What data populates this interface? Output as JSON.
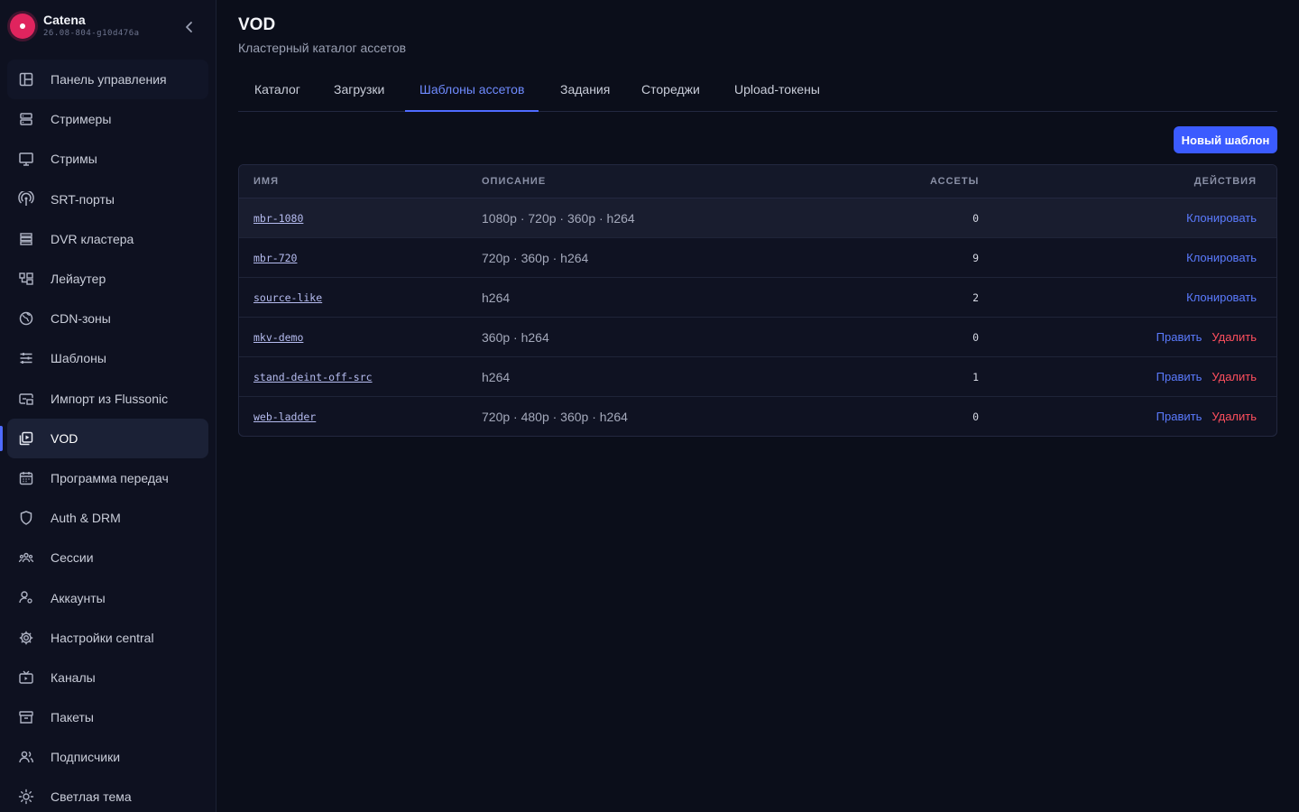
{
  "brand": {
    "name": "Catena",
    "version": "26.08-804-g10d476a"
  },
  "sidebar": {
    "items": [
      {
        "label": "Панель управления",
        "icon": "dashboard-icon"
      },
      {
        "label": "Стримеры",
        "icon": "server-icon"
      },
      {
        "label": "Стримы",
        "icon": "monitor-icon"
      },
      {
        "label": "SRT-порты",
        "icon": "antenna-icon"
      },
      {
        "label": "DVR кластера",
        "icon": "stack-icon"
      },
      {
        "label": "Лейаутер",
        "icon": "layout-icon"
      },
      {
        "label": "CDN-зоны",
        "icon": "globe-icon"
      },
      {
        "label": "Шаблоны",
        "icon": "sliders-icon"
      },
      {
        "label": "Импорт из Flussonic",
        "icon": "import-icon"
      },
      {
        "label": "VOD",
        "icon": "vod-icon"
      },
      {
        "label": "Программа передач",
        "icon": "calendar-icon"
      },
      {
        "label": "Auth & DRM",
        "icon": "shield-icon"
      },
      {
        "label": "Сессии",
        "icon": "users-group-icon"
      },
      {
        "label": "Аккаунты",
        "icon": "user-gear-icon"
      },
      {
        "label": "Настройки central",
        "icon": "gear-icon"
      },
      {
        "label": "Каналы",
        "icon": "tv-icon"
      },
      {
        "label": "Пакеты",
        "icon": "archive-icon"
      },
      {
        "label": "Подписчики",
        "icon": "subscribers-icon"
      },
      {
        "label": "Светлая тема",
        "icon": "sun-icon"
      }
    ],
    "active_index": 9
  },
  "header": {
    "title": "VOD",
    "subtitle": "Кластерный каталог ассетов"
  },
  "tabs": [
    {
      "label": "Каталог"
    },
    {
      "label": "Загрузки"
    },
    {
      "label": "Шаблоны ассетов"
    },
    {
      "label": "Задания"
    },
    {
      "label": "Стореджи"
    },
    {
      "label": "Upload-токены"
    }
  ],
  "active_tab": "Шаблоны ассетов",
  "new_button": "Новый шаблон",
  "table": {
    "columns": [
      "ИМЯ",
      "ОПИСАНИЕ",
      "АССЕТЫ",
      "ДЕЙСТВИЯ"
    ],
    "rows": [
      {
        "name": "mbr-1080",
        "description": "1080p · 720p · 360p · h264",
        "assets": "0",
        "action1": "Клонировать",
        "action2": ""
      },
      {
        "name": "mbr-720",
        "description": "720p · 360p · h264",
        "assets": "9",
        "action1": "Клонировать",
        "action2": ""
      },
      {
        "name": "source-like",
        "description": "h264",
        "assets": "2",
        "action1": "Клонировать",
        "action2": ""
      },
      {
        "name": "mkv-demo",
        "description": "360p · h264",
        "assets": "0",
        "action1": "Править",
        "action2": "Удалить"
      },
      {
        "name": "stand-deint-off-src",
        "description": "h264",
        "assets": "1",
        "action1": "Править",
        "action2": "Удалить"
      },
      {
        "name": "web-ladder",
        "description": "720p · 480p · 360p · h264",
        "assets": "0",
        "action1": "Править",
        "action2": "Удалить"
      }
    ]
  },
  "colors": {
    "accent": "#4f6bff",
    "danger": "#ff4f5e",
    "brand": "#e0245e"
  }
}
